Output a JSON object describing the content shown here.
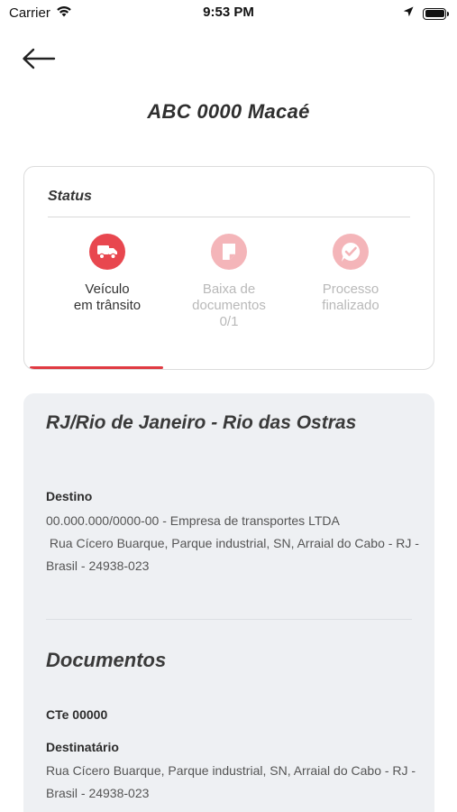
{
  "status_bar": {
    "carrier": "Carrier",
    "time": "9:53 PM",
    "icons": [
      "wifi-icon",
      "location-arrow-icon",
      "battery-icon"
    ]
  },
  "header": {
    "back_icon": "arrow-left-icon",
    "title": "ABC 0000 Macaé"
  },
  "status_card": {
    "heading": "Status",
    "steps": [
      {
        "label_line1": "Veículo",
        "label_line2": "em trânsito",
        "label_line3": "",
        "icon": "truck-icon",
        "state": "active"
      },
      {
        "label_line1": "Baixa de",
        "label_line2": "documentos",
        "label_line3": "0/1",
        "icon": "document-icon",
        "state": "pending"
      },
      {
        "label_line1": "Processo",
        "label_line2": "finalizado",
        "label_line3": "",
        "icon": "check-icon",
        "state": "pending"
      }
    ],
    "progress_fraction": 0.333,
    "accent_color": "#e8474f",
    "muted_color": "#f4b5b9"
  },
  "detail_card": {
    "route_title": "RJ/Rio de Janeiro - Rio das Ostras",
    "destino_label": "Destino",
    "destino_company": "00.000.000/0000-00 - Empresa de transportes LTDA",
    "destino_address": " Rua Cícero Buarque, Parque industrial, SN, Arraial do Cabo - RJ - Brasil - 24938-023",
    "documents_title": "Documentos",
    "cte": "CTe 00000",
    "destinatario_label": "Destinatário",
    "destinatario_address": "Rua Cícero Buarque, Parque industrial, SN, Arraial do Cabo - RJ - Brasil - 24938-023",
    "background_color": "#eef0f3"
  }
}
